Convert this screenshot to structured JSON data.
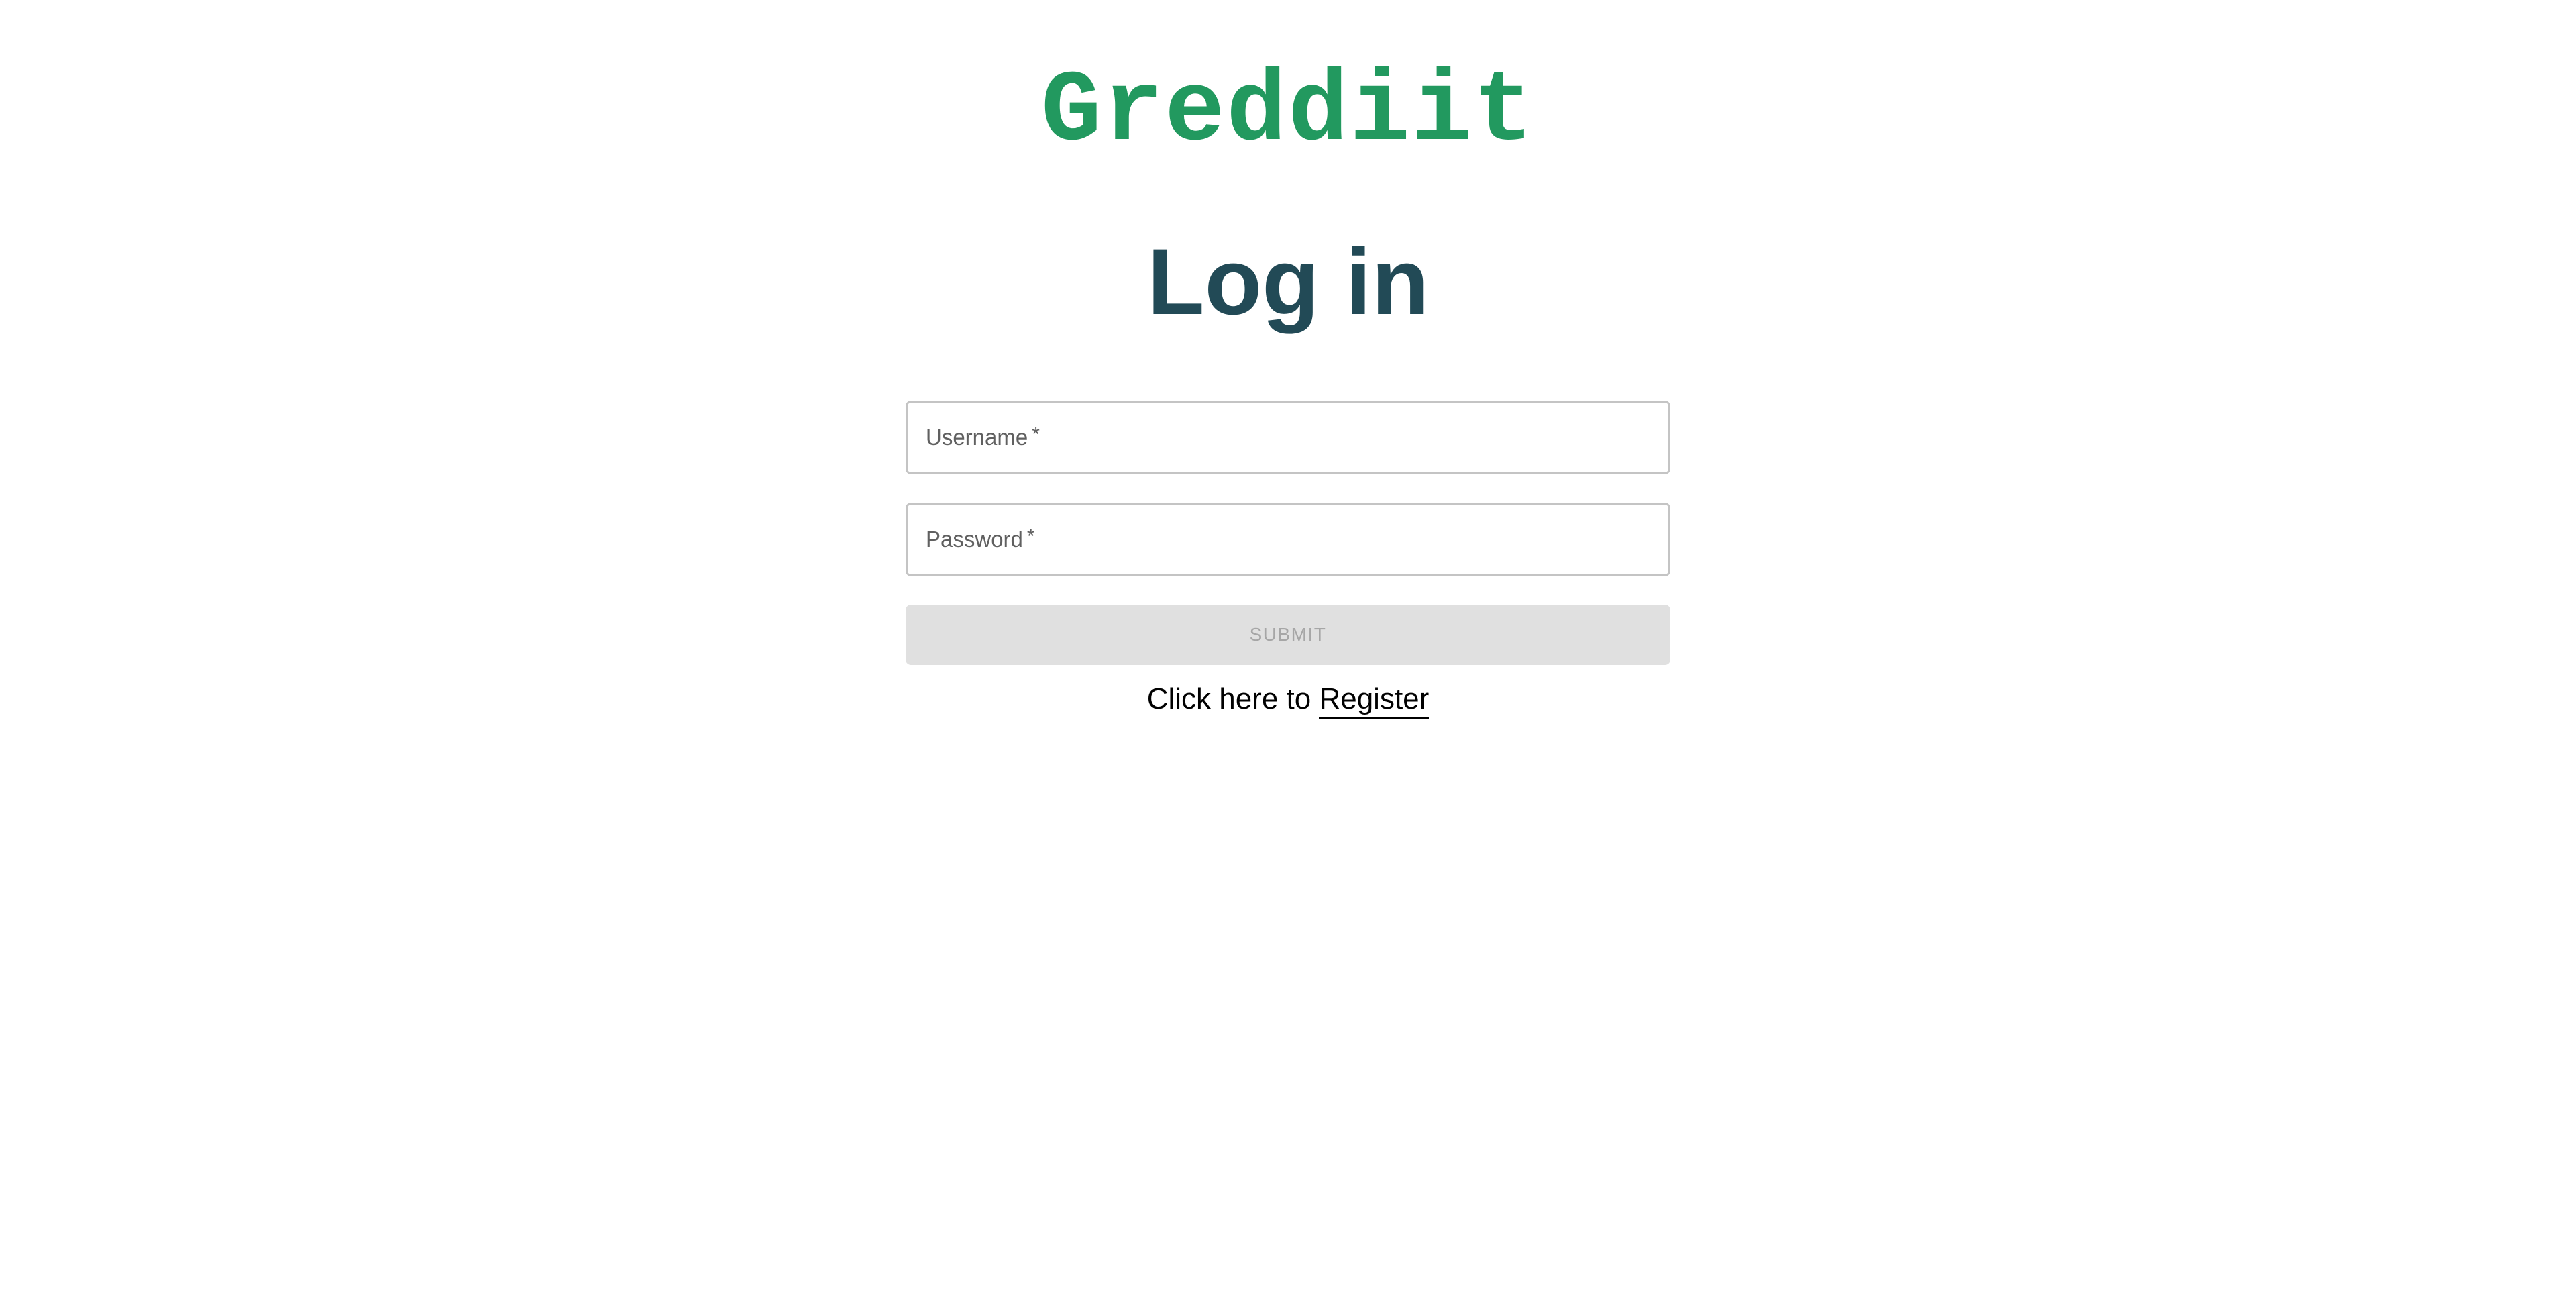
{
  "brand": {
    "name": "Greddiit",
    "color": "#22995f"
  },
  "page": {
    "title": "Log in",
    "title_color": "#224a56"
  },
  "form": {
    "username": {
      "label": "Username",
      "required_mark": "*",
      "value": ""
    },
    "password": {
      "label": "Password",
      "required_mark": "*",
      "value": ""
    },
    "submit": {
      "label": "SUBMIT",
      "disabled": true
    }
  },
  "register": {
    "prompt": "Click here to",
    "link_label": "Register"
  }
}
